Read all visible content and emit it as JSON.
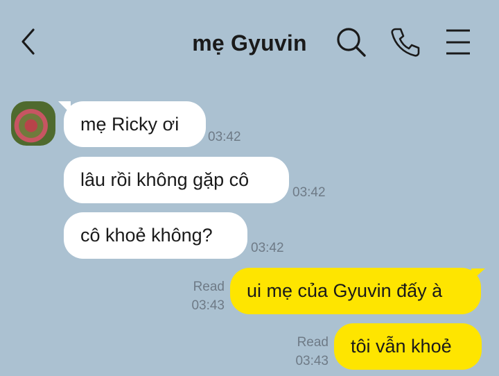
{
  "header": {
    "title": "mẹ Gyuvin",
    "back_icon": "chevron-left-icon",
    "search_icon": "search-icon",
    "call_icon": "phone-icon",
    "menu_icon": "menu-icon"
  },
  "messages": [
    {
      "direction": "incoming",
      "text": "mẹ Ricky ơi",
      "time": "03:42"
    },
    {
      "direction": "incoming",
      "text": "lâu rồi không gặp cô",
      "time": "03:42"
    },
    {
      "direction": "incoming",
      "text": "cô khoẻ không?",
      "time": "03:42"
    },
    {
      "direction": "outgoing",
      "text": "ui mẹ của Gyuvin đấy à",
      "read": "Read",
      "time": "03:43"
    },
    {
      "direction": "outgoing",
      "text": "tôi vẫn khoẻ",
      "read": "Read",
      "time": "03:43"
    }
  ],
  "colors": {
    "background": "#abc1d1",
    "incoming_bubble": "#ffffff",
    "outgoing_bubble": "#fee500",
    "meta_text": "#6e7a86"
  }
}
